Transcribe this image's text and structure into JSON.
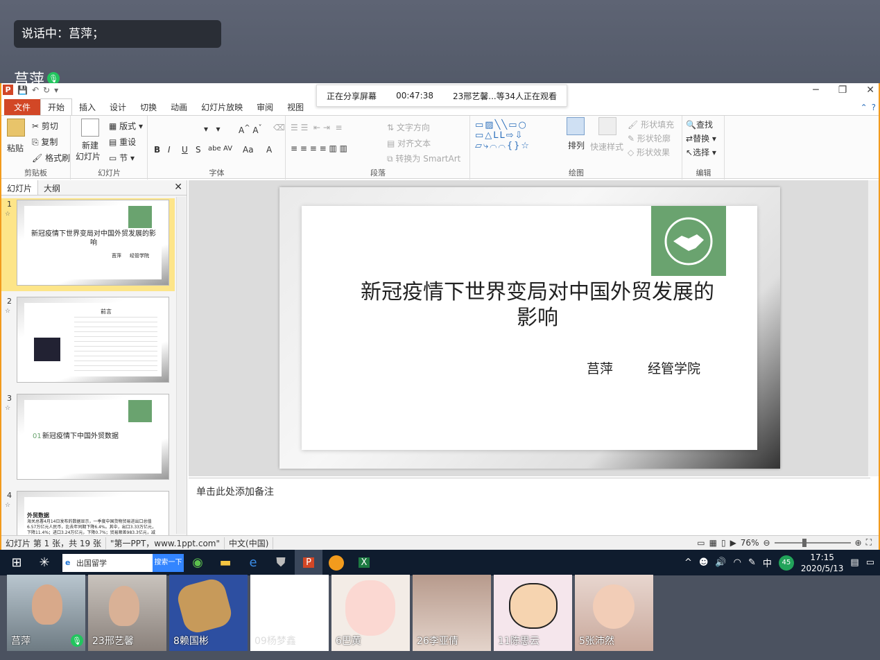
{
  "meeting": {
    "speaking_label": "说话中：莒萍；",
    "presenter_name": "莒萍"
  },
  "share_bar": {
    "status": "正在分享屏幕",
    "elapsed": "00:47:38",
    "viewers": "23邢艺馨...等34人正在观看"
  },
  "ribbon_tabs": [
    "文件",
    "开始",
    "插入",
    "设计",
    "切换",
    "动画",
    "幻灯片放映",
    "审阅",
    "视图"
  ],
  "ribbon": {
    "clipboard": {
      "paste": "粘贴",
      "cut": "剪切",
      "copy": "复制",
      "format_painter": "格式刷",
      "label": "剪贴板"
    },
    "slides": {
      "new_slide_line1": "新建",
      "new_slide_line2": "幻灯片",
      "layout": "版式",
      "reset": "重设",
      "section": "节",
      "label": "幻灯片"
    },
    "font": {
      "label": "字体"
    },
    "paragraph": {
      "text_direction": "文字方向",
      "align_text": "对齐文本",
      "convert_smartart": "转换为 SmartArt",
      "label": "段落"
    },
    "drawing": {
      "arrange": "排列",
      "quick_styles": "快速样式",
      "shape_fill": "形状填充",
      "shape_outline": "形状轮廓",
      "shape_effects": "形状效果",
      "label": "绘图"
    },
    "editing": {
      "find": "查找",
      "replace": "替换",
      "select": "选择",
      "label": "编辑"
    }
  },
  "slides_pane": {
    "tab_slides": "幻灯片",
    "tab_outline": "大纲",
    "close": "✕",
    "thumbnails": [
      {
        "num": "1",
        "title": "新冠疫情下世界变局对中国外贸发展的影响",
        "author": "莒萍",
        "dept": "经管学院"
      },
      {
        "num": "2",
        "title": "前言"
      },
      {
        "num": "3",
        "title": "新冠疫情下中国外贸数据",
        "prefix": "01"
      },
      {
        "num": "4",
        "title": "外贸数据",
        "body": "海关总署4月14日发布的数据显示，一季度中国货物贸易进出口总值6.57万亿元人民币，比去年同期下降6.4%。其中，出口3.33万亿元，下降11.4%；进口3.24万亿元，下降0.7%；贸易顺差983.3亿元，减少"
      }
    ]
  },
  "slide": {
    "title_line1": "新冠疫情下世界变局对中国外贸发展的",
    "title_line2": "影响",
    "author": "莒萍",
    "department": "经管学院"
  },
  "notes_placeholder": "单击此处添加备注",
  "status": {
    "slide_info": "幻灯片 第 1 张，共 19 张",
    "theme": "\"第一PPT，www.1ppt.com\"",
    "language": "中文(中国)",
    "zoom": "76%"
  },
  "taskbar": {
    "search_text": "出国留学",
    "search_button": "搜索一下",
    "ime": "中",
    "badge_count": "45",
    "time": "17:15",
    "date": "2020/5/13"
  },
  "participants": [
    {
      "name": "莒萍"
    },
    {
      "name": "23邢艺馨"
    },
    {
      "name": "8赖国彬"
    },
    {
      "name": "09杨梦鑫"
    },
    {
      "name": "6巴黄"
    },
    {
      "name": "26李亚倩"
    },
    {
      "name": "11陈思云"
    },
    {
      "name": "5张沛然"
    }
  ],
  "colors": {
    "accent_orange": "#f29b1d",
    "ppt_red": "#d24726",
    "slide_green": "#6aa36f"
  }
}
